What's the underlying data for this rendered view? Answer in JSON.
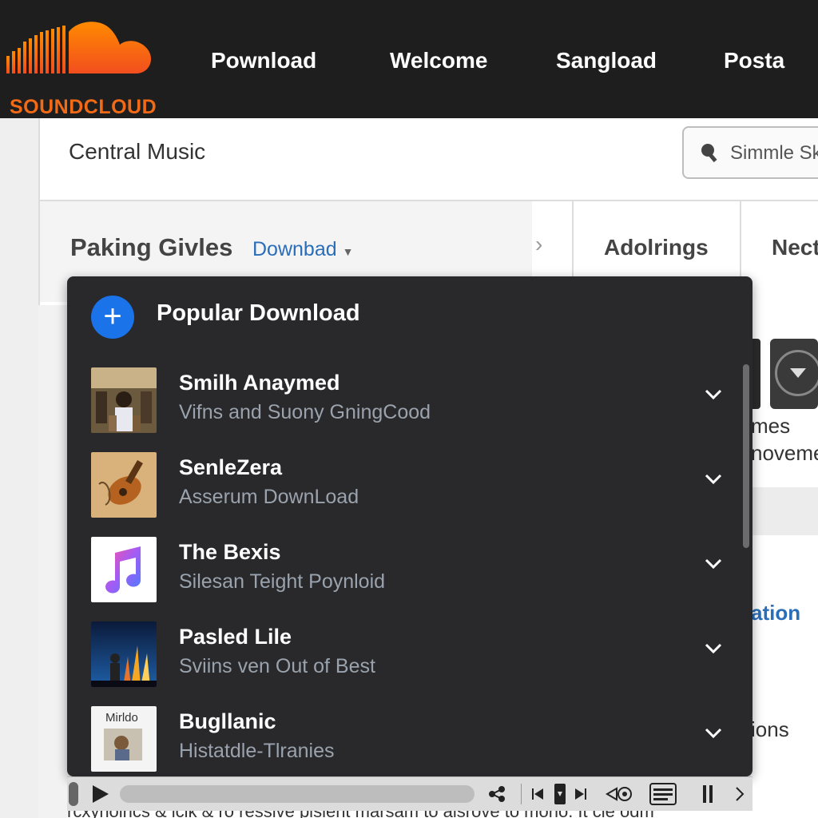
{
  "app": {
    "logo_text": "SOUNDCLOUD",
    "brand_color": "#f26a16"
  },
  "nav": {
    "items": [
      "Pownload",
      "Welcome",
      "Sangload",
      "Posta"
    ]
  },
  "header": {
    "title": "Central Music",
    "search_placeholder": "Simmle Sk"
  },
  "section": {
    "title": "Paking Givles",
    "download_link": "Downbad",
    "tabs": [
      "Adolrings",
      "Nect"
    ]
  },
  "popup": {
    "title": "Popular Download",
    "items": [
      {
        "title": "Smilh Anaymed",
        "subtitle": "Vifns and Suony GningCood",
        "art": "group-photo"
      },
      {
        "title": "SenleZera",
        "subtitle": "Asserum DownLoad",
        "art": "guitar"
      },
      {
        "title": "The Bexis",
        "subtitle": "Silesan Teight Poynloid",
        "art": "music-note"
      },
      {
        "title": "Pasled Lile",
        "subtitle": "Sviins ven Out of Best",
        "art": "concert"
      },
      {
        "title": "Bugllanic",
        "subtitle": "Histatdle-Tlranies",
        "art": "album-mirldo",
        "art_text": "Mirldo"
      }
    ]
  },
  "background": {
    "right_texts": [
      "mes",
      "noveme",
      "ation",
      "ions"
    ],
    "bottom_text": "rcxynoirics & lcik & ro ressive plsient marsam to alsrove to mono. It cle odm"
  },
  "player": {
    "controls": [
      "play-icon",
      "share-icon",
      "prev-icon",
      "device-icon",
      "next-icon",
      "cast-icon",
      "queue-icon",
      "pause-icon",
      "more-icon"
    ]
  }
}
